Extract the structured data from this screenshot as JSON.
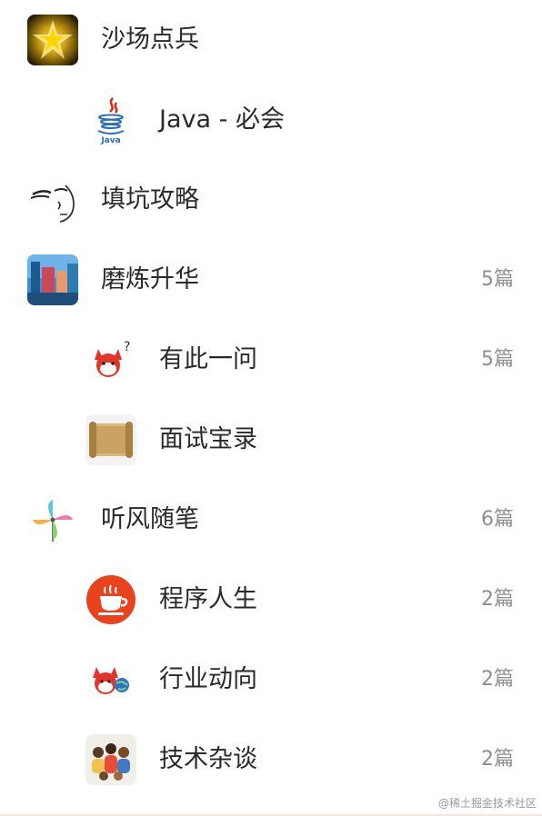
{
  "items": [
    {
      "label": "沙场点兵",
      "count": "",
      "icon": "golden-star-icon"
    },
    {
      "label": "Java - 必会",
      "count": "",
      "icon": "java-logo-icon"
    },
    {
      "label": "填坑攻略",
      "count": "",
      "icon": "sketch-face-icon"
    },
    {
      "label": "磨炼升华",
      "count": "5篇",
      "icon": "landscape-photo-icon"
    },
    {
      "label": "有此一问",
      "count": "5篇",
      "icon": "red-fox-question-icon"
    },
    {
      "label": "面试宝录",
      "count": "",
      "icon": "scroll-icon"
    },
    {
      "label": "听风随笔",
      "count": "6篇",
      "icon": "pinwheel-icon"
    },
    {
      "label": "程序人生",
      "count": "2篇",
      "icon": "coffee-cup-icon"
    },
    {
      "label": "行业动向",
      "count": "2篇",
      "icon": "red-fox-globe-icon"
    },
    {
      "label": "技术杂谈",
      "count": "2篇",
      "icon": "group-people-icon"
    }
  ],
  "watermark": "@稀土掘金技术社区",
  "colors": {
    "label": "#2a2a2a",
    "count": "#8e8e93",
    "background": "#ffffff"
  }
}
